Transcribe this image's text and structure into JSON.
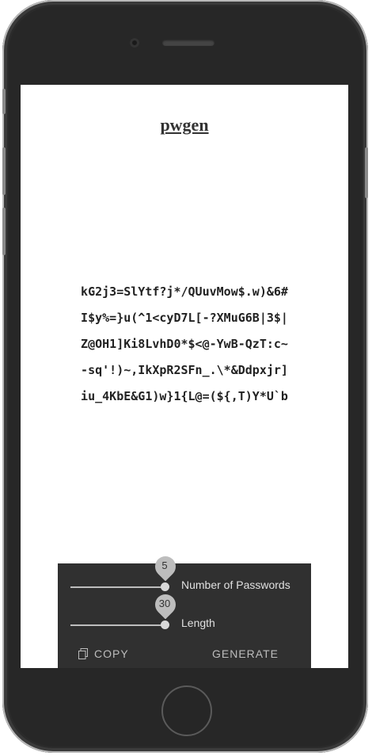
{
  "app": {
    "title": "pwgen"
  },
  "passwords": [
    "kG2j3=SlYtf?j*/QUuvMow$.w)&6#",
    "I$y%=}u(^1<cyD7L[-?XMuG6B|3$|",
    "Z@OH1]Ki8LvhD0*$<@-YwB-QzT:c~",
    "-sq'!)~,IkXpR2SFn_.\\*&Ddpxjr]",
    "iu_4KbE&G1)w}1{L@=(${,T)Y*U`b"
  ],
  "controls": {
    "count": {
      "label": "Number of Passwords",
      "value": "5"
    },
    "length": {
      "label": "Length",
      "value": "30"
    }
  },
  "actions": {
    "copy_label": "COPY",
    "generate_label": "GENERATE"
  }
}
